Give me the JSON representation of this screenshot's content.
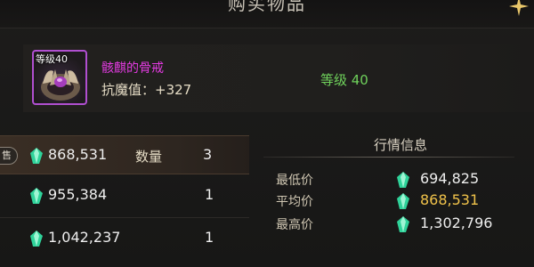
{
  "window": {
    "title": "购买物品"
  },
  "item": {
    "level_badge": "等级40",
    "name": "骸麒的骨戒",
    "stat": "抗魔值：+327",
    "required_level": "等级 40",
    "rarity_color": "#b04fd0"
  },
  "listings": {
    "sell_tag": "售",
    "quantity_label": "数量",
    "rows": [
      {
        "price": "868,531",
        "quantity": "3"
      },
      {
        "price": "955,384",
        "quantity": "1"
      },
      {
        "price": "1,042,237",
        "quantity": "1"
      }
    ]
  },
  "market": {
    "title": "行情信息",
    "min_label": "最低价",
    "min_value": "694,825",
    "avg_label": "平均价",
    "avg_value": "868,531",
    "max_label": "最高价",
    "max_value": "1,302,796"
  },
  "icons": {
    "currency": "green-gem-icon",
    "close": "close-star-icon"
  },
  "colors": {
    "accent_gold": "#f0c24a",
    "level_green": "#6fd15b",
    "item_name_magenta": "#e23be0",
    "gem_green": "#2fd39a"
  }
}
